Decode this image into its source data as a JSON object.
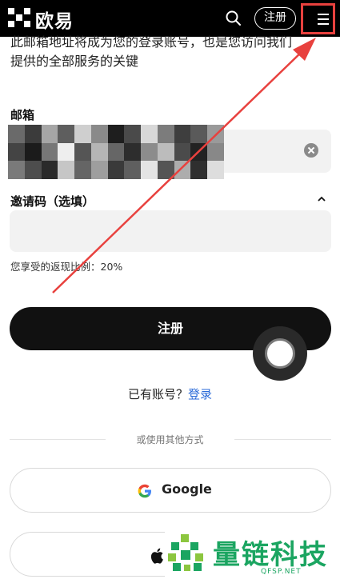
{
  "header": {
    "brand": "欧易",
    "register_label": "注册",
    "icons": [
      "okx-logo-icon",
      "search-icon",
      "menu-icon"
    ]
  },
  "form": {
    "intro_line1": "此邮箱地址将成为您的登录账号，也是您访问我们",
    "intro_line2": "提供的全部服务的关键",
    "email_label": "邮箱",
    "email_value": "",
    "invite_label": "邀请码（选填）",
    "invite_value": "",
    "rebate_text": "您享受的返现比例：20%",
    "submit_label": "注册"
  },
  "login": {
    "prompt": "已有账号？",
    "link": "登录"
  },
  "alt": {
    "divider_text": "或使用其他方式",
    "google_label": "Google"
  },
  "watermark": {
    "title": "量链科技",
    "url": "QFSP.NET"
  },
  "colors": {
    "header_bg": "#000000",
    "primary": "#111111",
    "link": "#2a6ad8",
    "annotation": "#e8413e",
    "watermark": "#1ba561"
  }
}
